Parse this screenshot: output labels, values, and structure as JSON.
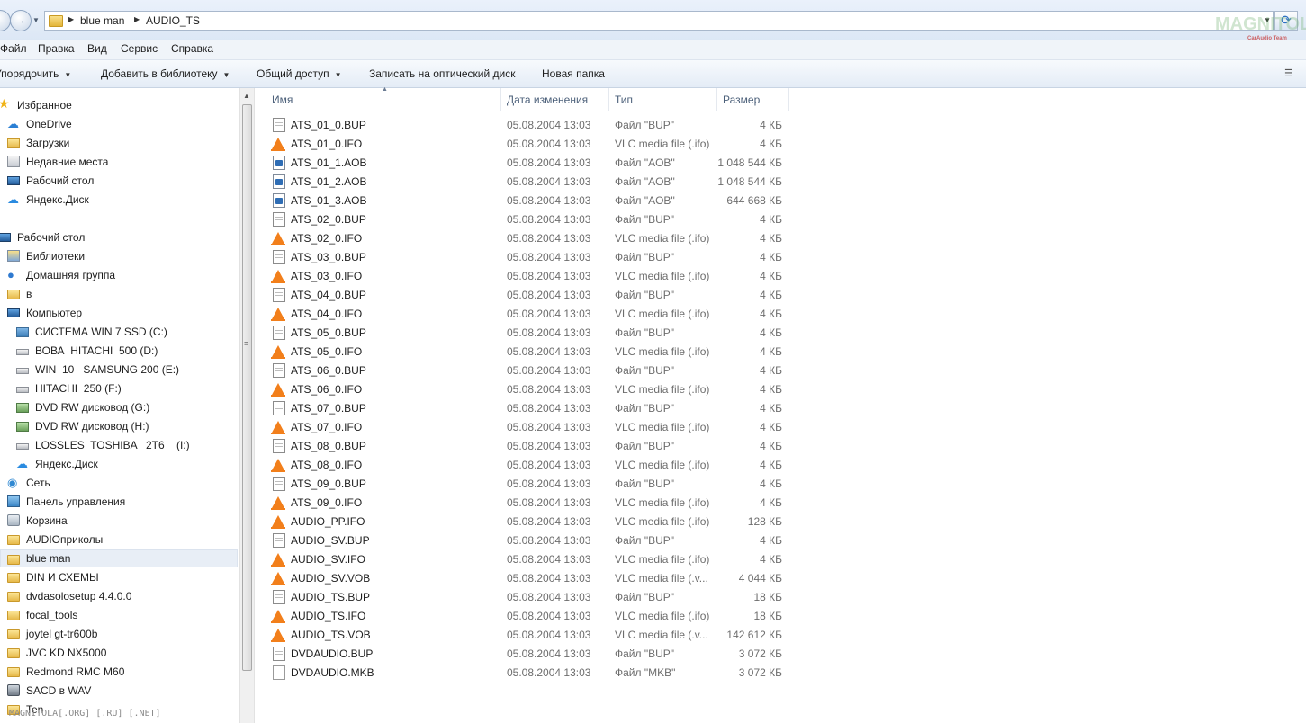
{
  "address": {
    "crumbs": [
      "blue man",
      "AUDIO_TS"
    ],
    "watermark": "MAGNITOLA",
    "watermark_sub": "CarAudio Team"
  },
  "menu": [
    "Файл",
    "Правка",
    "Вид",
    "Сервис",
    "Справка"
  ],
  "toolbar": {
    "organize": "Упорядочить",
    "add_library": "Добавить в библиотеку",
    "share": "Общий доступ",
    "burn": "Записать на оптический диск",
    "new_folder": "Новая папка"
  },
  "nav": {
    "favorites": "Избранное",
    "onedrive": "OneDrive",
    "downloads": "Загрузки",
    "recent": "Недавние места",
    "desktop_fav": "Рабочий стол",
    "yadisk_fav": "Яндекс.Диск",
    "desktop": "Рабочий стол",
    "libraries": "Библиотеки",
    "homegroup": "Домашняя группа",
    "user": "в",
    "computer": "Компьютер",
    "drive_c": "СИСТЕМА WIN 7 SSD (C:)",
    "drive_d": "ВОВА  HITACHI  500 (D:)",
    "drive_e": "WIN  10   SAMSUNG 200 (E:)",
    "drive_f": "HITACHI  250 (F:)",
    "drive_g": "DVD RW дисковод (G:)",
    "drive_h": "DVD RW дисковод (H:)",
    "drive_i": "LOSSLES  TOSHIBA   2T6    (I:)",
    "yadisk_comp": "Яндекс.Диск",
    "network": "Сеть",
    "control_panel": "Панель управления",
    "recycle": "Корзина",
    "f1": "AUDIOприколы",
    "f2": "blue man",
    "f3": "DIN И СХЕМЫ",
    "f4": "dvdasolosetup 4.4.0.0",
    "f5": "focal_tools",
    "f6": "joytel gt-tr600b",
    "f7": "JVC KD NX5000",
    "f8": "Redmond RMC M60",
    "f9": "SACD в WAV",
    "f10": "Ten",
    "bottom_watermark": "MAGNITOLA[.ORG] [.RU] [.NET]"
  },
  "columns": {
    "name": "Имя",
    "date": "Дата изменения",
    "type": "Тип",
    "size": "Размер"
  },
  "files": [
    {
      "name": "ATS_01_0.BUP",
      "date": "05.08.2004 13:03",
      "type": "Файл \"BUP\"",
      "size": "4 КБ",
      "icon": "doc-icon"
    },
    {
      "name": "ATS_01_0.IFO",
      "date": "05.08.2004 13:03",
      "type": "VLC media file (.ifo)",
      "size": "4 КБ",
      "icon": "vlc-icon"
    },
    {
      "name": "ATS_01_1.AOB",
      "date": "05.08.2004 13:03",
      "type": "Файл \"AOB\"",
      "size": "1 048 544 КБ",
      "icon": "aob-icon"
    },
    {
      "name": "ATS_01_2.AOB",
      "date": "05.08.2004 13:03",
      "type": "Файл \"AOB\"",
      "size": "1 048 544 КБ",
      "icon": "aob-icon"
    },
    {
      "name": "ATS_01_3.AOB",
      "date": "05.08.2004 13:03",
      "type": "Файл \"AOB\"",
      "size": "644 668 КБ",
      "icon": "aob-icon"
    },
    {
      "name": "ATS_02_0.BUP",
      "date": "05.08.2004 13:03",
      "type": "Файл \"BUP\"",
      "size": "4 КБ",
      "icon": "doc-icon"
    },
    {
      "name": "ATS_02_0.IFO",
      "date": "05.08.2004 13:03",
      "type": "VLC media file (.ifo)",
      "size": "4 КБ",
      "icon": "vlc-icon"
    },
    {
      "name": "ATS_03_0.BUP",
      "date": "05.08.2004 13:03",
      "type": "Файл \"BUP\"",
      "size": "4 КБ",
      "icon": "doc-icon"
    },
    {
      "name": "ATS_03_0.IFO",
      "date": "05.08.2004 13:03",
      "type": "VLC media file (.ifo)",
      "size": "4 КБ",
      "icon": "vlc-icon"
    },
    {
      "name": "ATS_04_0.BUP",
      "date": "05.08.2004 13:03",
      "type": "Файл \"BUP\"",
      "size": "4 КБ",
      "icon": "doc-icon"
    },
    {
      "name": "ATS_04_0.IFO",
      "date": "05.08.2004 13:03",
      "type": "VLC media file (.ifo)",
      "size": "4 КБ",
      "icon": "vlc-icon"
    },
    {
      "name": "ATS_05_0.BUP",
      "date": "05.08.2004 13:03",
      "type": "Файл \"BUP\"",
      "size": "4 КБ",
      "icon": "doc-icon"
    },
    {
      "name": "ATS_05_0.IFO",
      "date": "05.08.2004 13:03",
      "type": "VLC media file (.ifo)",
      "size": "4 КБ",
      "icon": "vlc-icon"
    },
    {
      "name": "ATS_06_0.BUP",
      "date": "05.08.2004 13:03",
      "type": "Файл \"BUP\"",
      "size": "4 КБ",
      "icon": "doc-icon"
    },
    {
      "name": "ATS_06_0.IFO",
      "date": "05.08.2004 13:03",
      "type": "VLC media file (.ifo)",
      "size": "4 КБ",
      "icon": "vlc-icon"
    },
    {
      "name": "ATS_07_0.BUP",
      "date": "05.08.2004 13:03",
      "type": "Файл \"BUP\"",
      "size": "4 КБ",
      "icon": "doc-icon"
    },
    {
      "name": "ATS_07_0.IFO",
      "date": "05.08.2004 13:03",
      "type": "VLC media file (.ifo)",
      "size": "4 КБ",
      "icon": "vlc-icon"
    },
    {
      "name": "ATS_08_0.BUP",
      "date": "05.08.2004 13:03",
      "type": "Файл \"BUP\"",
      "size": "4 КБ",
      "icon": "doc-icon"
    },
    {
      "name": "ATS_08_0.IFO",
      "date": "05.08.2004 13:03",
      "type": "VLC media file (.ifo)",
      "size": "4 КБ",
      "icon": "vlc-icon"
    },
    {
      "name": "ATS_09_0.BUP",
      "date": "05.08.2004 13:03",
      "type": "Файл \"BUP\"",
      "size": "4 КБ",
      "icon": "doc-icon"
    },
    {
      "name": "ATS_09_0.IFO",
      "date": "05.08.2004 13:03",
      "type": "VLC media file (.ifo)",
      "size": "4 КБ",
      "icon": "vlc-icon"
    },
    {
      "name": "AUDIO_PP.IFO",
      "date": "05.08.2004 13:03",
      "type": "VLC media file (.ifo)",
      "size": "128 КБ",
      "icon": "vlc-icon"
    },
    {
      "name": "AUDIO_SV.BUP",
      "date": "05.08.2004 13:03",
      "type": "Файл \"BUP\"",
      "size": "4 КБ",
      "icon": "doc-icon"
    },
    {
      "name": "AUDIO_SV.IFO",
      "date": "05.08.2004 13:03",
      "type": "VLC media file (.ifo)",
      "size": "4 КБ",
      "icon": "vlc-icon"
    },
    {
      "name": "AUDIO_SV.VOB",
      "date": "05.08.2004 13:03",
      "type": "VLC media file (.v...",
      "size": "4 044 КБ",
      "icon": "vlc-icon"
    },
    {
      "name": "AUDIO_TS.BUP",
      "date": "05.08.2004 13:03",
      "type": "Файл \"BUP\"",
      "size": "18 КБ",
      "icon": "doc-icon"
    },
    {
      "name": "AUDIO_TS.IFO",
      "date": "05.08.2004 13:03",
      "type": "VLC media file (.ifo)",
      "size": "18 КБ",
      "icon": "vlc-icon"
    },
    {
      "name": "AUDIO_TS.VOB",
      "date": "05.08.2004 13:03",
      "type": "VLC media file (.v...",
      "size": "142 612 КБ",
      "icon": "vlc-icon"
    },
    {
      "name": "DVDAUDIO.BUP",
      "date": "05.08.2004 13:03",
      "type": "Файл \"BUP\"",
      "size": "3 072 КБ",
      "icon": "doc-icon"
    },
    {
      "name": "DVDAUDIO.MKB",
      "date": "05.08.2004 13:03",
      "type": "Файл \"MKB\"",
      "size": "3 072 КБ",
      "icon": "blank-file-icon"
    }
  ]
}
